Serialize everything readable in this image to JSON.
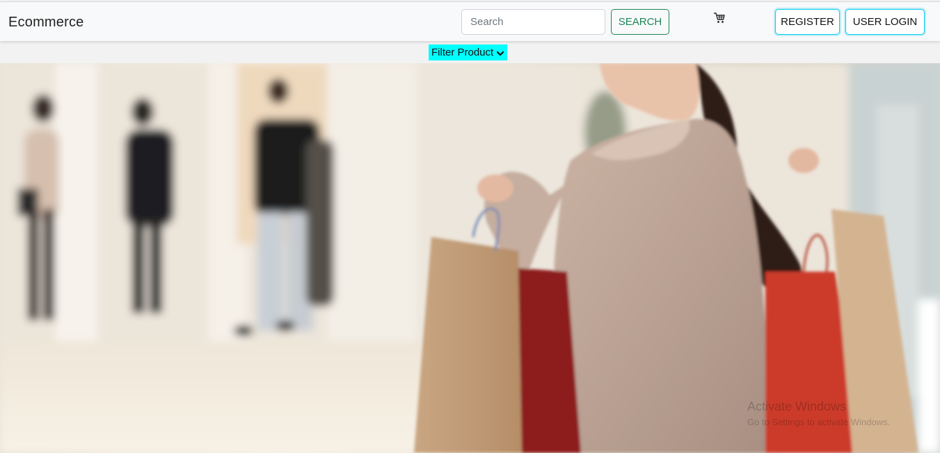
{
  "header": {
    "brand": "Ecommerce",
    "search": {
      "placeholder": "Search",
      "value": ""
    },
    "search_button": "SEARCH",
    "cart_icon": "shopping-cart-icon",
    "register_button": "REGISTER",
    "login_button": "USER LOGIN"
  },
  "filter": {
    "label": "Filter Product",
    "icon": "chevron-down-icon",
    "bg_color": "#00ffff"
  },
  "watermark": {
    "line1": "Activate Windows",
    "line2": "Go to Settings to activate Windows."
  },
  "colors": {
    "search_accent": "#198754",
    "auth_accent": "#0dcaf0"
  }
}
